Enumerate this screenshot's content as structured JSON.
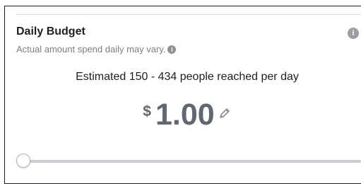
{
  "budget": {
    "title": "Daily Budget",
    "subtitle": "Actual amount spend daily may vary.",
    "info_icon_glyph": "i",
    "info_icon_name": "info-icon",
    "reach_text": "Estimated 150 - 434 people reached per day",
    "currency_symbol": "$",
    "amount": "1.00",
    "edit_icon_name": "pencil-icon",
    "slider_value_fraction": 0.0
  },
  "colors": {
    "text_primary": "#1c1e21",
    "text_secondary": "#7b7f84",
    "amount": "#606770",
    "track": "#c9ccd1"
  }
}
